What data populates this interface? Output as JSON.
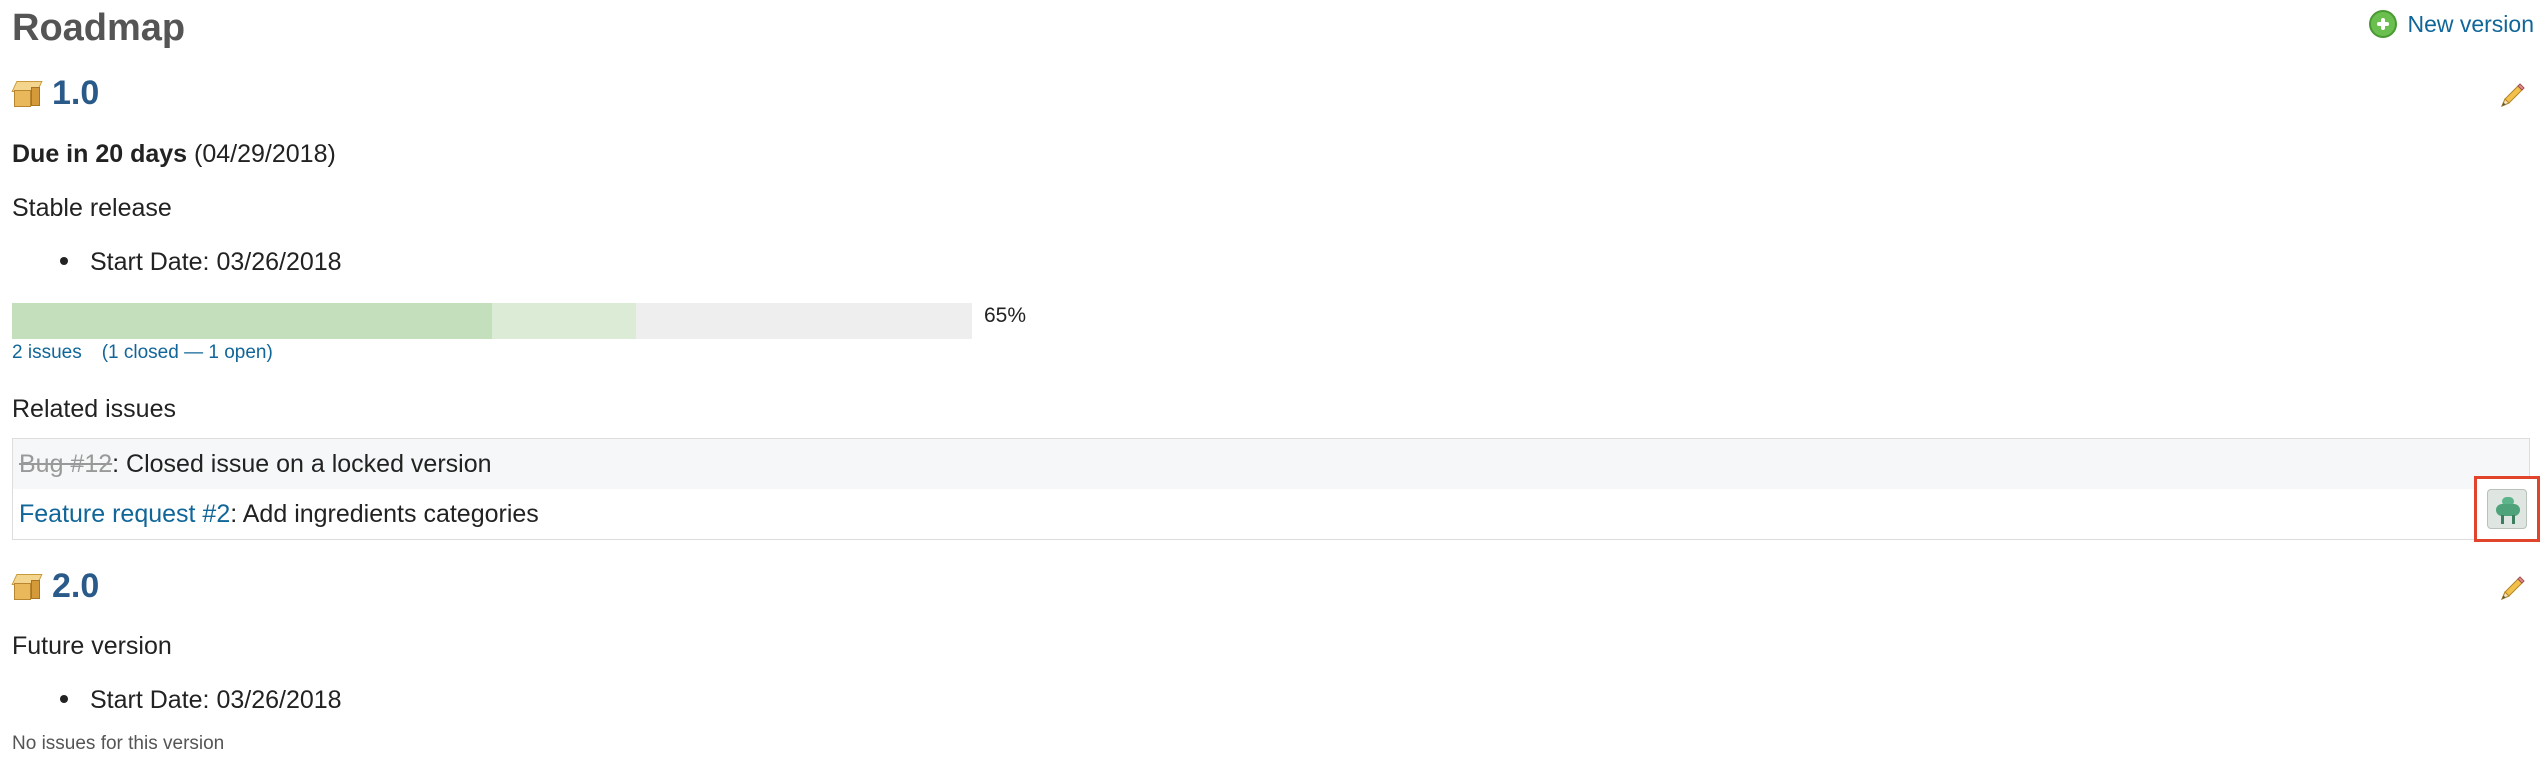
{
  "header": {
    "title": "Roadmap",
    "new_version_label": "New version"
  },
  "versions": [
    {
      "name": "1.0",
      "due_bold": "Due in 20 days",
      "due_date": "(04/29/2018)",
      "description": "Stable release",
      "start_date": "Start Date: 03/26/2018",
      "progress": {
        "closed_percent": 50,
        "done_percent": 65,
        "label": "65%"
      },
      "issue_count_label": "2 issues",
      "issue_breakdown_open_paren": "(",
      "closed_label": "1 closed",
      "separator": " — ",
      "open_label": "1 open",
      "issue_breakdown_close_paren": ")",
      "related_title": "Related issues",
      "related_issues": [
        {
          "link": "Bug #12",
          "subject": ": Closed issue on a locked version",
          "closed": true
        },
        {
          "link": "Feature request #2",
          "subject": ": Add ingredients categories",
          "closed": false
        }
      ]
    },
    {
      "name": "2.0",
      "description": "Future version",
      "start_date": "Start Date: 03/26/2018",
      "no_issues_label": "No issues for this version"
    }
  ],
  "icons": {
    "new_version": "add-icon",
    "version": "package-icon",
    "edit": "pencil-icon",
    "assignee": "avatar-icon"
  },
  "colors": {
    "link": "#1166aa",
    "version_link": "#2a5a8a",
    "progress_closed": "#c4dfbc",
    "progress_done": "#dcebd6",
    "progress_bg": "#eeeeee",
    "highlight_border": "#e0452b"
  }
}
